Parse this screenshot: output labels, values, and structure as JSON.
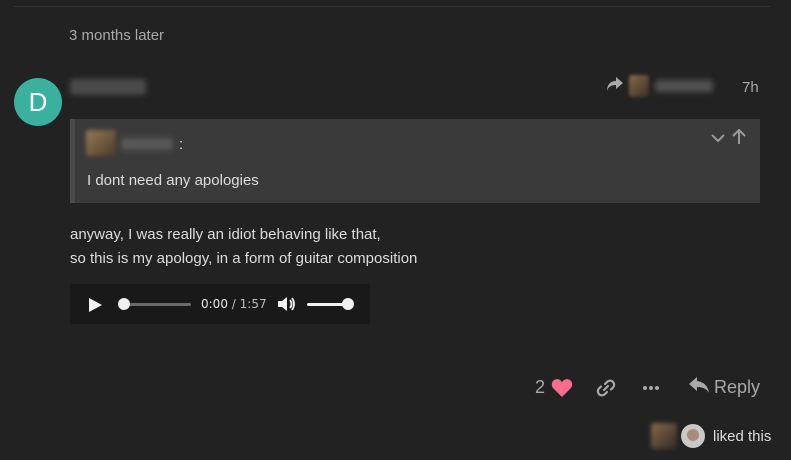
{
  "time_gap_label": "3 months later",
  "post": {
    "avatar_letter": "D",
    "date": "7h",
    "quote": {
      "colon": ":",
      "text": "I dont need any apologies"
    },
    "body_lines": [
      "anyway, I was really an idiot behaving like that,",
      "so this is my apology, in a form of guitar composition"
    ],
    "audio": {
      "current_time": "0:00",
      "separator": "/",
      "duration": "1:57",
      "progress": 0.0,
      "volume": 1.0
    }
  },
  "actions": {
    "like_count": "2",
    "reply_label": "Reply"
  },
  "liked_by_label": "liked this",
  "colors": {
    "background": "#222222",
    "avatar": "#3ab09e",
    "heart": "#fa6c8d",
    "muted": "#a9a9a9"
  }
}
